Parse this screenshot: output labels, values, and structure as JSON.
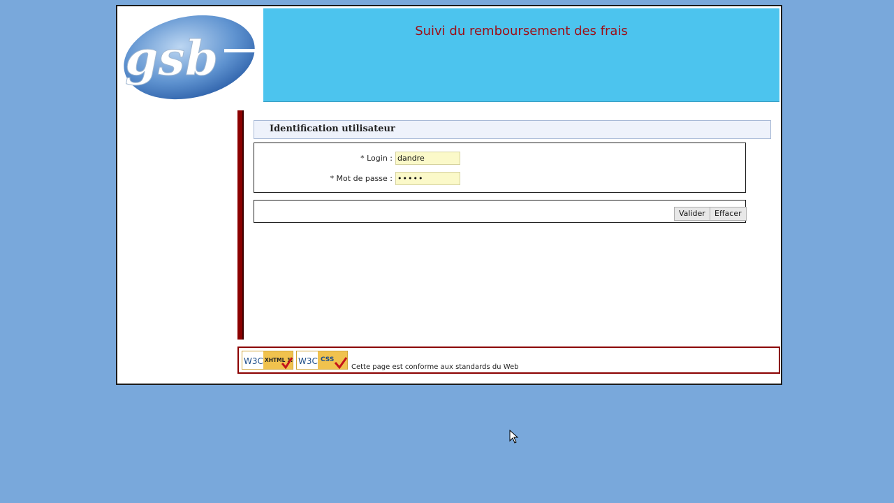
{
  "app": {
    "title": "Suivi du remboursement des frais",
    "logo_text": "gsb"
  },
  "colors": {
    "desktop_bg": "#79a8db",
    "banner_bg": "#4cc4ee",
    "title_red": "#9c0e16",
    "accent_dark_red": "#8b0000",
    "input_bg": "#fbf9c9"
  },
  "section": {
    "title": "Identification utilisateur"
  },
  "form": {
    "login": {
      "label": "* Login :",
      "value": "dandre"
    },
    "password": {
      "label": "* Mot de passe :",
      "value": "•••••"
    }
  },
  "buttons": {
    "validate": "Valider",
    "clear": "Effacer"
  },
  "footer": {
    "xhtml_badge": {
      "left": "W3C",
      "right": "XHTML 1.0"
    },
    "css_badge": {
      "left": "W3C",
      "right": "CSS"
    },
    "text": "Cette page est conforme aux standards du Web"
  }
}
